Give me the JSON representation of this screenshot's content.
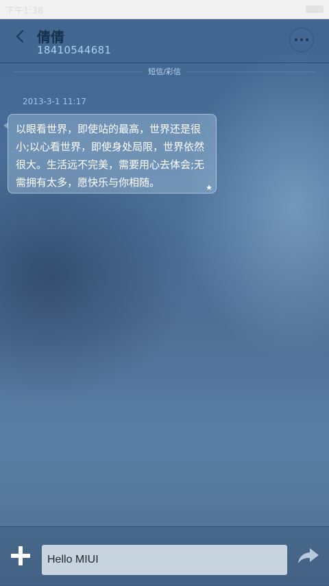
{
  "status_bar": {
    "time": "下午1:38"
  },
  "header": {
    "contact_name": "倩倩",
    "contact_number": "18410544681"
  },
  "divider_label": "短信/彩信",
  "messages": [
    {
      "timestamp": "2013-3-1 11:17",
      "text": "以眼看世界，即使站的最高，世界还是很小;以心看世界，即使身处局限，世界依然很大。生活远不完美，需要用心去体会;无需拥有太多，愿快乐与你相随。",
      "starred": true
    }
  ],
  "composer": {
    "value": "Hello MIUI"
  },
  "icons": {
    "back": "back-arrow-icon",
    "more": "more-dots-icon",
    "add": "plus-icon",
    "send": "send-arrow-icon",
    "star": "star-icon"
  },
  "colors": {
    "contact_number": "#a9d1f5",
    "input_bg": "#c7d3df"
  }
}
